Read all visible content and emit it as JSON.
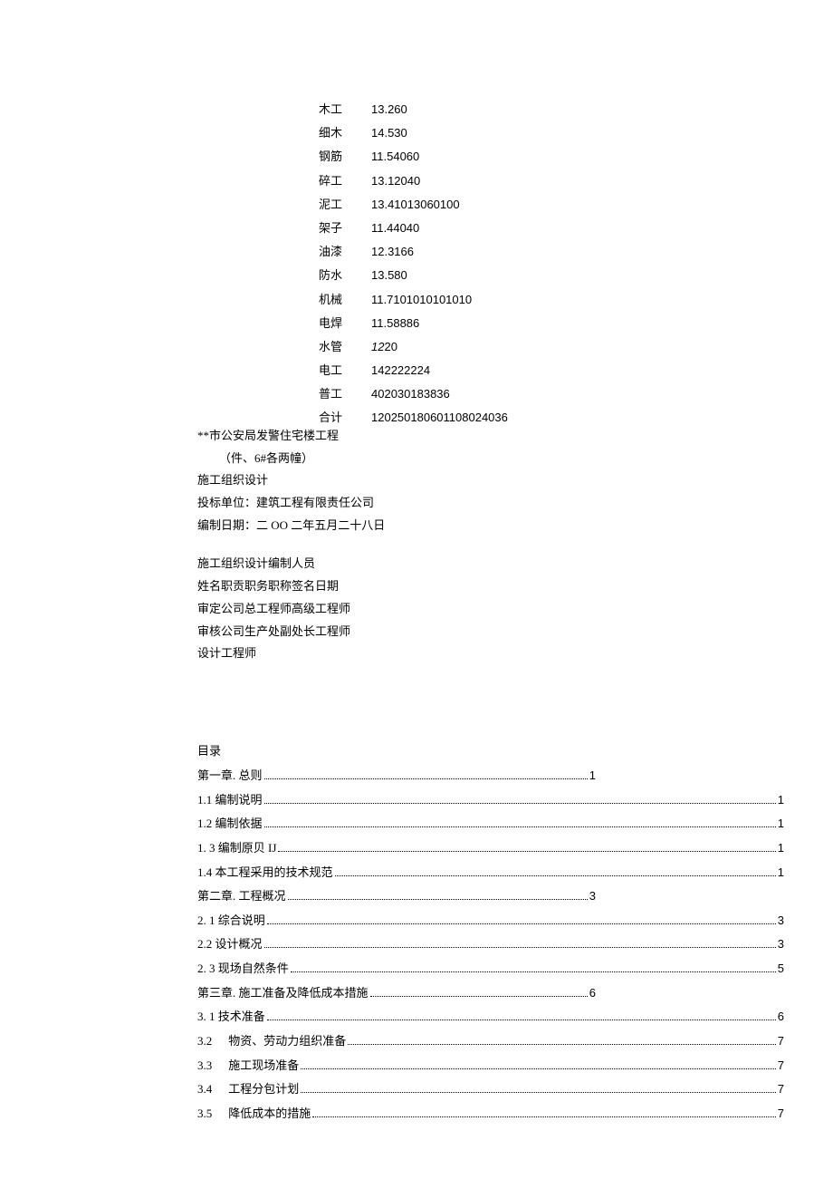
{
  "table": [
    {
      "label": "木工",
      "value": "13.260"
    },
    {
      "label": "细木",
      "value": "14.530"
    },
    {
      "label": "钢筋",
      "value": "11.54060"
    },
    {
      "label": "碎工",
      "value": "13.12040"
    },
    {
      "label": "泥工",
      "value": "13.41013060100"
    },
    {
      "label": "架子",
      "value": "11.44040"
    },
    {
      "label": "油漆",
      "value": "12.3166"
    },
    {
      "label": "防水",
      "value": "13.580"
    },
    {
      "label": "机械",
      "value": "11.7101010101010"
    },
    {
      "label": "电焊",
      "value": "11.58886"
    },
    {
      "label": "水管",
      "value": "1220",
      "italic_prefix": "12"
    },
    {
      "label": "电工",
      "value": "142222224"
    },
    {
      "label": "普工",
      "value": "402030183836"
    },
    {
      "label": "合计",
      "value": "120250180601108024036"
    }
  ],
  "header": {
    "line1": "**市公安局发警住宅楼工程",
    "line2": "（件、6#各两幢）",
    "line3": "施工组织设计",
    "line4": "投标单位：建筑工程有限责任公司",
    "line5": "编制日期：二 OO 二年五月二十八日"
  },
  "personnel": {
    "title": "施工组织设计编制人员",
    "line1": "姓名职贡职务职称签名日期",
    "line2": "审定公司总工程师高级工程师",
    "line3": "审核公司生产处副处长工程师",
    "line4": "设计工程师"
  },
  "toc_title": "目录",
  "toc": [
    {
      "label": "第一章. 总则",
      "page": "1",
      "short": true
    },
    {
      "label": "1.1 编制说明",
      "page": "1"
    },
    {
      "label": "1.2 编制依据",
      "page": "1"
    },
    {
      "label": "1.  3 编制原贝 IJ",
      "page": "1"
    },
    {
      "label": "1.4 本工程采用的技术规范",
      "page": "1"
    },
    {
      "label": "第二章. 工程概况",
      "page": "3",
      "short": true
    },
    {
      "label": "2.  1 综合说明",
      "page": "3"
    },
    {
      "label": "2.2 设计概况",
      "page": "3"
    },
    {
      "label": "2.  3 现场自然条件",
      "page": "5"
    },
    {
      "label": "第三章. 施工准备及降低成本措施",
      "page": "6",
      "short": true
    },
    {
      "label": "3.  1 技术准备",
      "page": "6"
    },
    {
      "num": "3.2",
      "label": "物资、劳动力组织准备",
      "page": "7"
    },
    {
      "num": "3.3",
      "label": "施工现场准备",
      "page": "7"
    },
    {
      "num": "3.4",
      "label": "工程分包计划",
      "page": "7"
    },
    {
      "num": "3.5",
      "label": "降低成本的措施",
      "page": "7"
    }
  ]
}
